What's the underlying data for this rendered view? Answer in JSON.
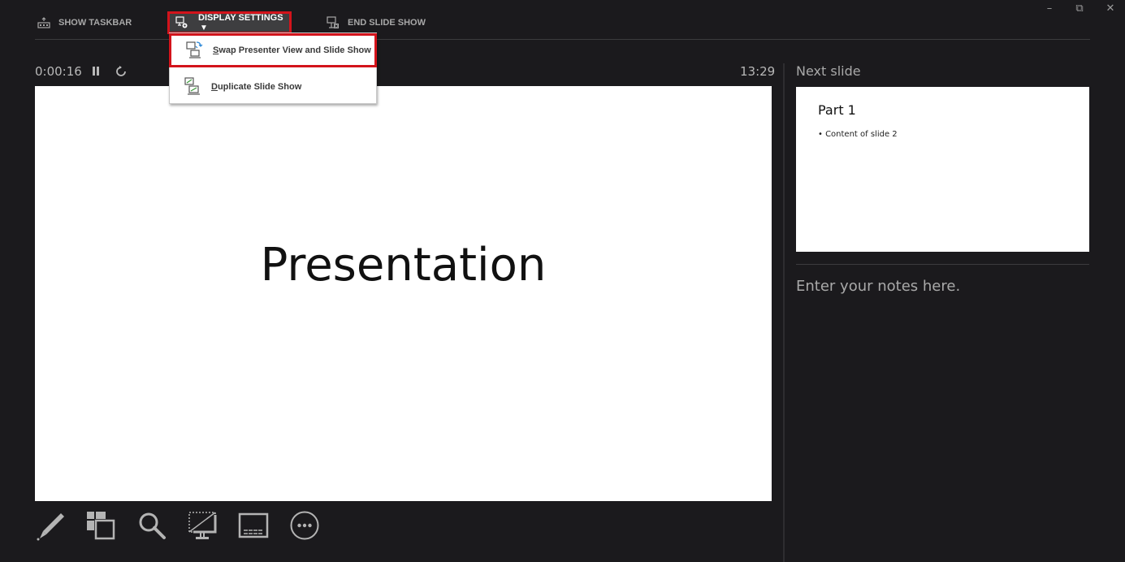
{
  "toolbar": {
    "show_taskbar_label": "SHOW TASKBAR",
    "display_settings_label": "DISPLAY SETTINGS",
    "display_settings_caret": "▼",
    "end_slide_show_label": "END SLIDE SHOW"
  },
  "window_controls": {
    "minimize": "–",
    "restore": "⧉",
    "close": "✕"
  },
  "display_menu": {
    "items": [
      {
        "accel": "S",
        "rest": "wap Presenter View and Slide Show",
        "icon": "swap-monitors-icon",
        "highlighted": true
      },
      {
        "accel": "D",
        "rest": "uplicate Slide Show",
        "icon": "duplicate-monitors-icon",
        "highlighted": false
      }
    ]
  },
  "timer": {
    "elapsed": "0:00:16",
    "clock": "13:29"
  },
  "current_slide": {
    "title": "Presentation"
  },
  "next_slide": {
    "label": "Next slide",
    "title": "Part 1",
    "bullet": "• Content of slide 2"
  },
  "notes": {
    "placeholder": "Enter your notes here."
  },
  "bottom_tools": [
    {
      "name": "pen-tool",
      "icon": "pen-icon"
    },
    {
      "name": "see-all-slides",
      "icon": "slide-grid-icon"
    },
    {
      "name": "zoom-into-slide",
      "icon": "magnifier-icon"
    },
    {
      "name": "black-screen",
      "icon": "blackout-monitor-icon"
    },
    {
      "name": "subtitles",
      "icon": "subtitles-icon"
    },
    {
      "name": "more-options",
      "icon": "more-icon"
    }
  ],
  "colors": {
    "background": "#1b1a1d",
    "highlight_border": "#d3131b",
    "text_muted": "#a9a9a9"
  }
}
